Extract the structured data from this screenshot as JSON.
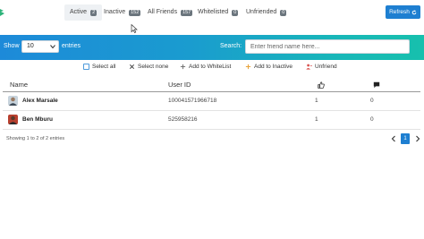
{
  "tabs": [
    {
      "label": "Active",
      "count": "2"
    },
    {
      "label": "Inactive",
      "count": "152"
    },
    {
      "label": "All Friends",
      "count": "157"
    },
    {
      "label": "Whitelisted",
      "count": "0"
    },
    {
      "label": "Unfriended",
      "count": "0"
    }
  ],
  "refresh_label": "Refresh",
  "length": {
    "show_label": "Show",
    "selected": "10",
    "entries_label": "entries"
  },
  "search": {
    "label": "Search:",
    "placeholder": "Enter friend name here..."
  },
  "actions": {
    "select_all": "Select all",
    "select_none": "Select none",
    "add_whitelist": "Add to WhiteList",
    "add_inactive": "Add to Inactive",
    "unfriend": "Unfriend"
  },
  "table": {
    "headers": {
      "name": "Name",
      "user_id": "User ID"
    },
    "rows": [
      {
        "name": "Alex Marsale",
        "user_id": "100041571966718",
        "likes": "1",
        "comments": "0"
      },
      {
        "name": "Ben Mburu",
        "user_id": "525958216",
        "likes": "1",
        "comments": "0"
      }
    ]
  },
  "footer": {
    "info": "Showing 1 to 2 of 2 entries",
    "page": "1"
  },
  "colors": {
    "accent": "#1e7fd1",
    "gradient_start": "#1d8ad9",
    "gradient_end": "#17c0ad",
    "add_icon": "#e8a33a",
    "unfriend_icon": "#d9534f"
  }
}
